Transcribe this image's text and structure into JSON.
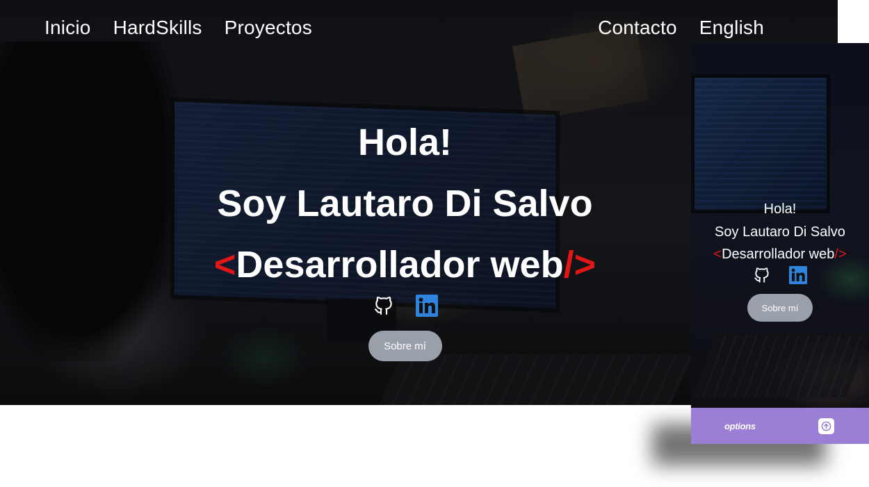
{
  "nav": {
    "left": [
      "Inicio",
      "HardSkills",
      "Proyectos"
    ],
    "right": [
      "Contacto",
      "English"
    ]
  },
  "hero": {
    "greeting": "Hola!",
    "name": "Soy Lautaro Di Salvo",
    "role_open": "<",
    "role_text": "Desarrollador web",
    "role_close": "/>",
    "about_button": "Sobre mí",
    "socials": [
      {
        "icon": "github-icon"
      },
      {
        "icon": "linkedin-icon"
      }
    ]
  },
  "mobile": {
    "greeting": "Hola!",
    "name": "Soy Lautaro Di Salvo",
    "role_open": "<",
    "role_text": "Desarrollador web",
    "role_close": "/>",
    "about_button": "Sobre mí",
    "options_label": "options",
    "scroll_top_icon": "arrow-up-icon"
  },
  "colors": {
    "bracket": "#e11717",
    "button": "#9aa0aa",
    "linkedin": "#2f84dd",
    "mobile_bar": "#9b7fd6"
  }
}
